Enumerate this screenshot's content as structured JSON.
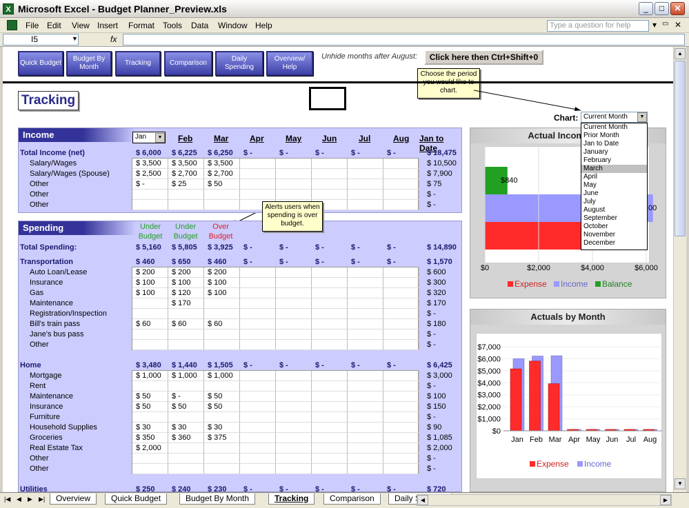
{
  "window": {
    "title": "Microsoft Excel - Budget Planner_Preview.xls",
    "excel_icon": "X"
  },
  "menu": {
    "items": [
      "File",
      "Edit",
      "View",
      "Insert",
      "Format",
      "Tools",
      "Data",
      "Window",
      "Help"
    ],
    "ask_placeholder": "Type a question for help"
  },
  "formula_bar": {
    "cell_ref": "I5",
    "fx": "fx",
    "value": ""
  },
  "toolbar_buttons": [
    "Quick Budget",
    "Budget By Month",
    "Tracking",
    "Comparison",
    "Daily Spending",
    "Overview/ Help"
  ],
  "unhide_text": "Unhide months after August:",
  "click_button": "Click here then Ctrl+Shift+0",
  "sheet_title": "Tracking",
  "callouts": {
    "period": "Choose the period you would like to chart.",
    "alerts": "Alerts users when spending is over budget."
  },
  "chart_selector": {
    "label": "Chart:",
    "value": "Current Month",
    "options": [
      "Current Month",
      "Prior Month",
      "Jan to Date",
      "January",
      "February",
      "March",
      "April",
      "May",
      "June",
      "July",
      "August",
      "September",
      "October",
      "November",
      "December"
    ],
    "highlighted": "March"
  },
  "months_header": {
    "month_dropdown": "Jan",
    "months": [
      "Feb",
      "Mar",
      "Apr",
      "May",
      "Jun",
      "Jul",
      "Aug"
    ],
    "jtd": "Jan to Date"
  },
  "income": {
    "header": "Income",
    "total_label": "Total Income (net)",
    "total": [
      "$ 6,000",
      "$ 6,225",
      "$ 6,250",
      "$ -",
      "$ -",
      "$ -",
      "$ -",
      "$ -",
      "$ 18,475"
    ],
    "rows": [
      {
        "label": "Salary/Wages",
        "vals": [
          "$ 3,500",
          "$ 3,500",
          "$ 3,500"
        ],
        "jtd": "$ 10,500"
      },
      {
        "label": "Salary/Wages (Spouse)",
        "vals": [
          "$ 2,500",
          "$ 2,700",
          "$ 2,700"
        ],
        "jtd": "$ 7,900"
      },
      {
        "label": "Other",
        "vals": [
          "$ -",
          "$ 25",
          "$ 50"
        ],
        "jtd": "$ 75"
      },
      {
        "label": "Other",
        "vals": [
          "",
          "",
          ""
        ],
        "jtd": "$ -"
      },
      {
        "label": "Other",
        "vals": [
          "",
          "",
          ""
        ],
        "jtd": "$ -"
      }
    ]
  },
  "spending": {
    "header": "Spending",
    "under1": "Under Budget",
    "under2": "Under Budget",
    "over": "Over Budget",
    "total_label": "Total Spending:",
    "total": [
      "$ 5,160",
      "$ 5,805",
      "$ 3,925",
      "$ -",
      "$ -",
      "$ -",
      "$ -",
      "$ -",
      "$ 14,890"
    ],
    "transport": {
      "label": "Transportation",
      "total": [
        "$ 460",
        "$ 650",
        "$ 460",
        "$ -",
        "$ -",
        "$ -",
        "$ -",
        "$ -",
        "$ 1,570"
      ],
      "rows": [
        {
          "label": "Auto Loan/Lease",
          "vals": [
            "$ 200",
            "$ 200",
            "$ 200"
          ],
          "jtd": "$ 600"
        },
        {
          "label": "Insurance",
          "vals": [
            "$ 100",
            "$ 100",
            "$ 100"
          ],
          "jtd": "$ 300"
        },
        {
          "label": "Gas",
          "vals": [
            "$ 100",
            "$ 120",
            "$ 100"
          ],
          "jtd": "$ 320"
        },
        {
          "label": "Maintenance",
          "vals": [
            "",
            "$ 170",
            ""
          ],
          "jtd": "$ 170"
        },
        {
          "label": "Registration/Inspection",
          "vals": [
            "",
            "",
            ""
          ],
          "jtd": "$ -"
        },
        {
          "label": "Bill's train pass",
          "vals": [
            "$ 60",
            "$ 60",
            "$ 60"
          ],
          "jtd": "$ 180"
        },
        {
          "label": "Jane's bus pass",
          "vals": [
            "",
            "",
            ""
          ],
          "jtd": "$ -"
        },
        {
          "label": "Other",
          "vals": [
            "",
            "",
            ""
          ],
          "jtd": "$ -"
        }
      ]
    },
    "home": {
      "label": "Home",
      "total": [
        "$ 3,480",
        "$ 1,440",
        "$ 1,505",
        "$ -",
        "$ -",
        "$ -",
        "$ -",
        "$ -",
        "$ 6,425"
      ],
      "rows": [
        {
          "label": "Mortgage",
          "vals": [
            "$ 1,000",
            "$ 1,000",
            "$ 1,000"
          ],
          "jtd": "$ 3,000"
        },
        {
          "label": "Rent",
          "vals": [
            "",
            "",
            ""
          ],
          "jtd": "$ -"
        },
        {
          "label": "Maintenance",
          "vals": [
            "$ 50",
            "$ -",
            "$ 50"
          ],
          "jtd": "$ 100"
        },
        {
          "label": "Insurance",
          "vals": [
            "$ 50",
            "$ 50",
            "$ 50"
          ],
          "jtd": "$ 150"
        },
        {
          "label": "Furniture",
          "vals": [
            "",
            "",
            ""
          ],
          "jtd": "$ -"
        },
        {
          "label": "Household Supplies",
          "vals": [
            "$ 30",
            "$ 30",
            "$ 30"
          ],
          "jtd": "$ 90"
        },
        {
          "label": "Groceries",
          "vals": [
            "$ 350",
            "$ 360",
            "$ 375"
          ],
          "jtd": "$ 1,085"
        },
        {
          "label": "Real Estate Tax",
          "vals": [
            "$ 2,000",
            "",
            ""
          ],
          "jtd": "$ 2,000"
        },
        {
          "label": "Other",
          "vals": [
            "",
            "",
            ""
          ],
          "jtd": "$ -"
        },
        {
          "label": "Other",
          "vals": [
            "",
            "",
            ""
          ],
          "jtd": "$ -"
        }
      ]
    },
    "utilities": {
      "label": "Utilities",
      "total": [
        "$ 250",
        "$ 240",
        "$ 230",
        "$ -",
        "$ -",
        "$ -",
        "$ -",
        "$ -",
        "$ 720"
      ]
    }
  },
  "chart_data": [
    {
      "type": "bar",
      "title": "Actual Income/Spe",
      "orientation": "horizontal",
      "series": [
        {
          "name": "Expense",
          "values": [
            3925
          ]
        },
        {
          "name": "Income",
          "values": [
            6250
          ]
        },
        {
          "name": "Balance",
          "values": [
            840
          ]
        }
      ],
      "data_labels": [
        "$840",
        "00"
      ],
      "xticks": [
        "$0",
        "$2,000",
        "$4,000",
        "$6,000"
      ],
      "xlim": [
        0,
        6000
      ],
      "colors": {
        "Expense": "#ff2a2a",
        "Income": "#9999ff",
        "Balance": "#22a022"
      }
    },
    {
      "type": "bar",
      "title": "Actuals by Month",
      "categories": [
        "Jan",
        "Feb",
        "Mar",
        "Apr",
        "May",
        "Jun",
        "Jul",
        "Aug"
      ],
      "series": [
        {
          "name": "Expense",
          "values": [
            5160,
            5805,
            3925,
            0,
            0,
            0,
            0,
            0
          ]
        },
        {
          "name": "Income",
          "values": [
            6000,
            6225,
            6250,
            0,
            0,
            0,
            0,
            0
          ]
        }
      ],
      "yticks": [
        "$7,000",
        "$6,000",
        "$5,000",
        "$4,000",
        "$3,000",
        "$2,000",
        "$1,000",
        "$0"
      ],
      "ylim": [
        0,
        7000
      ],
      "colors": {
        "Expense": "#ff2a2a",
        "Income": "#9999ff"
      }
    }
  ],
  "sheet_tabs": [
    "Overview",
    "Quick Budget",
    "Budget By Month",
    "Tracking",
    "Comparison",
    "Daily Spendin"
  ],
  "active_tab": "Tracking"
}
